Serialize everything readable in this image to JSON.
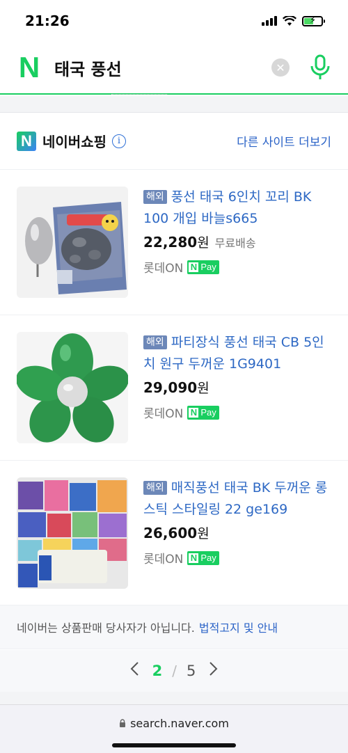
{
  "status_bar": {
    "time": "21:26"
  },
  "search": {
    "query": "태국 풍선",
    "logo": "N"
  },
  "shopping": {
    "logo": "N",
    "title": "네이버쇼핑",
    "more_link": "다른 사이트 더보기",
    "products": [
      {
        "badge": "해외",
        "title": "풍선 태국 6인치 꼬리 BK 100 개입 바늘s665",
        "price": "22,280",
        "currency": "원",
        "shipping": "무료배송",
        "seller": "롯데ON",
        "pay_n": "N",
        "pay_label": "Pay"
      },
      {
        "badge": "해외",
        "title": "파티장식 풍선 태국 CB 5인치 원구 두꺼운 1G9401",
        "price": "29,090",
        "currency": "원",
        "shipping": "",
        "seller": "롯데ON",
        "pay_n": "N",
        "pay_label": "Pay"
      },
      {
        "badge": "해외",
        "title": "매직풍선 태국 BK 두꺼운 롱스틱 스타일링 22 ge169",
        "price": "26,600",
        "currency": "원",
        "shipping": "",
        "seller": "롯데ON",
        "pay_n": "N",
        "pay_label": "Pay"
      }
    ]
  },
  "notice": {
    "text": "네이버는 상품판매 당사자가 아닙니다.",
    "link": "법적고지 및 안내"
  },
  "pagination": {
    "current": "2",
    "separator": "/",
    "total": "5"
  },
  "browser": {
    "url": "search.naver.com"
  },
  "colors": {
    "naver_green": "#19ce60",
    "link_blue": "#2d68c4"
  }
}
